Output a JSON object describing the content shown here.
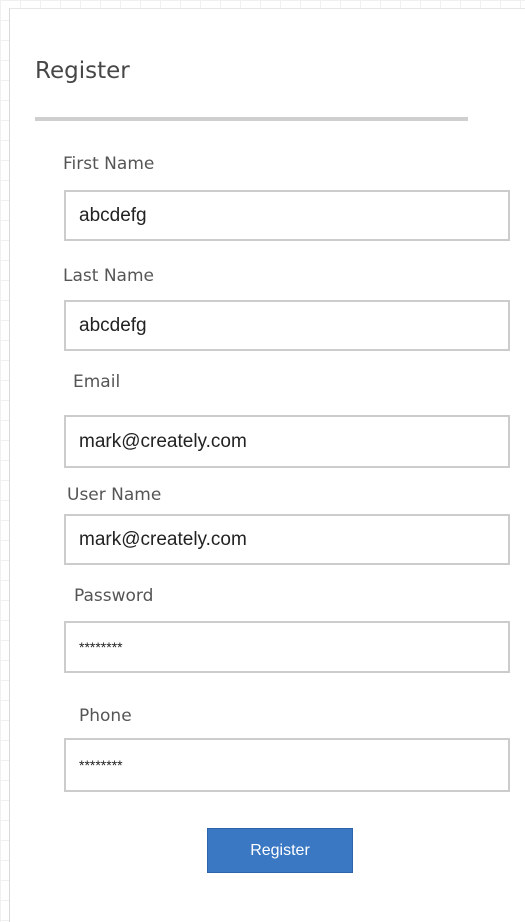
{
  "form": {
    "title": "Register",
    "fields": {
      "first_name": {
        "label": "First Name",
        "value": "abcdefg"
      },
      "last_name": {
        "label": "Last Name",
        "value": "abcdefg"
      },
      "email": {
        "label": "Email",
        "value": "mark@creately.com"
      },
      "user_name": {
        "label": "User Name",
        "value": "mark@creately.com"
      },
      "password": {
        "label": "Password",
        "value": "********"
      },
      "phone": {
        "label": "Phone",
        "value": "********"
      }
    },
    "submit_label": "Register"
  },
  "colors": {
    "button": "#3a78c4",
    "border": "#cccccc",
    "rule": "#cfcfcf"
  }
}
